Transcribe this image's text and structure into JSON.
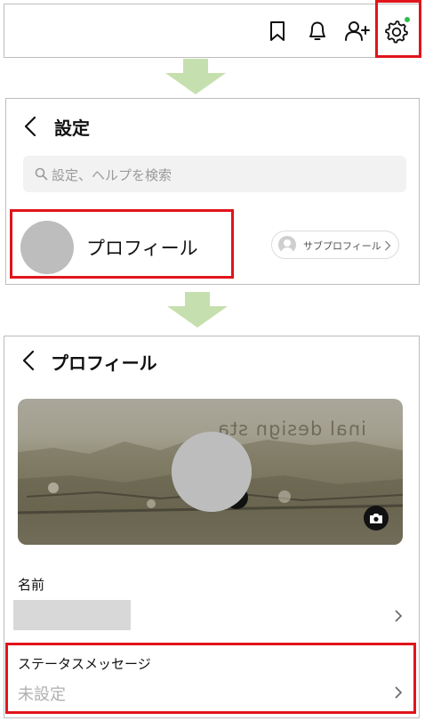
{
  "toolbar": {
    "icons": [
      "bookmark-icon",
      "bell-icon",
      "add-friend-icon",
      "gear-icon"
    ],
    "notification_dot_color": "#2dbd4b"
  },
  "settings": {
    "title": "設定",
    "search_placeholder": "設定、ヘルプを検索",
    "profile_label": "プロフィール",
    "sub_profile_label": "サブプロフィール"
  },
  "profile": {
    "title": "プロフィール",
    "cover_text": "inal design sta",
    "name_label": "名前",
    "name_value": "",
    "status_label": "ステータスメッセージ",
    "status_value": "未設定"
  },
  "colors": {
    "highlight": "#e0151b",
    "arrow": "#c6dfae"
  }
}
